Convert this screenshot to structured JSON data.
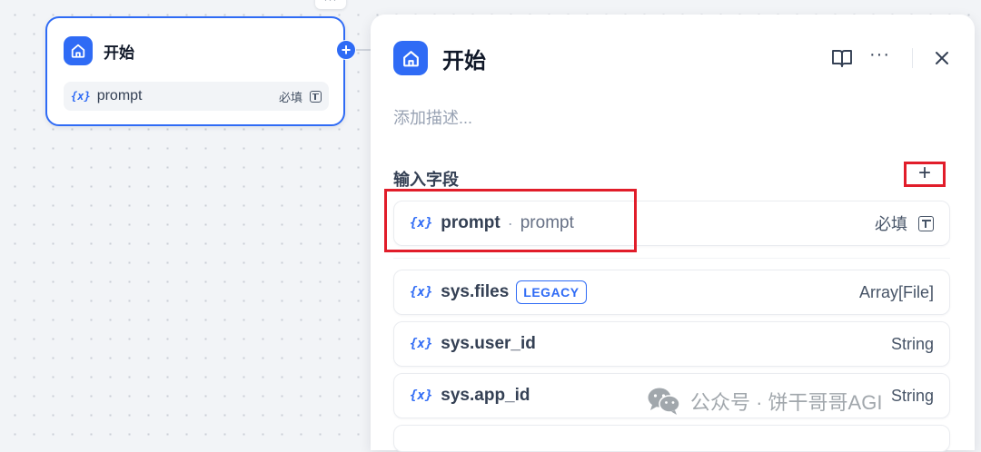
{
  "canvas": {
    "top_stub_text": "···"
  },
  "node": {
    "title": "开始",
    "icon": "home-icon",
    "variable": {
      "icon": "{x}",
      "name": "prompt",
      "required": "必填",
      "type_icon": "text-input-icon"
    }
  },
  "panel": {
    "title": "开始",
    "icon": "home-icon",
    "actions": {
      "more": "···"
    },
    "description_placeholder": "添加描述...",
    "input_section_title": "输入字段",
    "add_button": "+",
    "fields": [
      {
        "icon": "{x}",
        "name": "prompt",
        "separator": "·",
        "label": "prompt",
        "right": "必填",
        "type_icon": "text-input-icon"
      },
      {
        "icon": "{x}",
        "name": "sys.files",
        "badge": "LEGACY",
        "right": "Array[File]"
      },
      {
        "icon": "{x}",
        "name": "sys.user_id",
        "right": "String"
      },
      {
        "icon": "{x}",
        "name": "sys.app_id",
        "right": "String"
      }
    ]
  },
  "watermark": {
    "text": "公众号 · 饼干哥哥AGI"
  },
  "colors": {
    "accent": "#2f6bf5",
    "highlight_box": "#e11d2a",
    "canvas_bg": "#f2f4f7"
  }
}
